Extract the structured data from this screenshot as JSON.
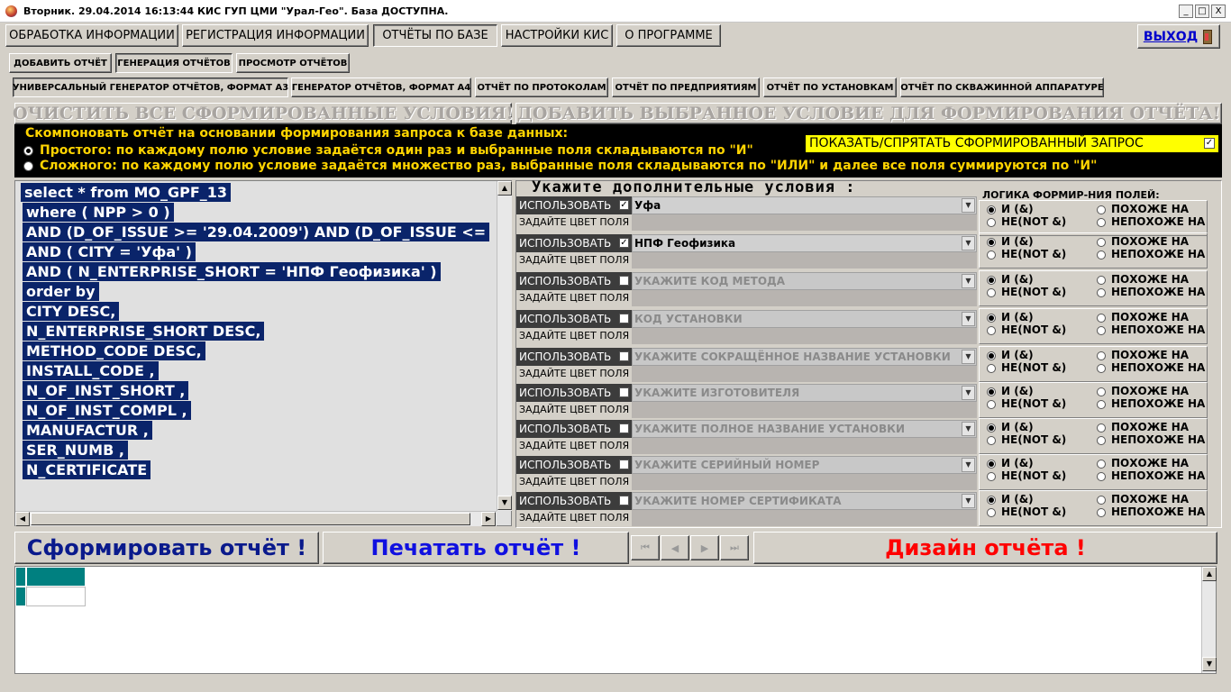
{
  "window": {
    "title": "Вторник. 29.04.2014 16:13:44  КИС ГУП ЦМИ \"Урал-Гео\". База ДОСТУПНА.",
    "min": "_",
    "max": "□",
    "close": "X"
  },
  "menu": {
    "items": [
      "ОБРАБОТКА ИНФОРМАЦИИ",
      "РЕГИСТРАЦИЯ ИНФОРМАЦИИ",
      "ОТЧЁТЫ ПО БАЗЕ",
      "НАСТРОЙКИ КИС",
      "О ПРОГРАММЕ"
    ],
    "exit": "ВЫХОД"
  },
  "subtabs": [
    "ДОБАВИТЬ ОТЧЁТ",
    "ГЕНЕРАЦИЯ ОТЧЁТОВ",
    "ПРОСМОТР ОТЧЁТОВ"
  ],
  "reporttabs": [
    "УНИВЕРСАЛЬНЫЙ ГЕНЕРАТОР ОТЧЁТОВ, ФОРМАТ А3",
    "ГЕНЕРАТОР ОТЧЁТОВ, ФОРМАТ А4",
    "ОТЧЁТ ПО ПРОТОКОЛАМ",
    "ОТЧЁТ ПО ПРЕДПРИЯТИЯМ",
    "ОТЧЁТ ПО УСТАНОВКАМ",
    "ОТЧЁТ ПО СКВАЖИННОЙ АППАРАТУРЕ"
  ],
  "actions": {
    "clear": "ОЧИСТИТЬ ВСЕ СФОРМИРОВАННЫЕ УСЛОВИЯ!",
    "add": "ДОБАВИТЬ ВЫБРАННОЕ УСЛОВИЕ ДЛЯ ФОРМИРОВАНИЯ  ОТЧЁТА!"
  },
  "mode": {
    "heading": "Скомпоновать отчёт на основании формирования запроса к базе данных:",
    "simple": "Простого: по каждому полю условие задаётся один раз и выбранные поля складываются по \"И\"",
    "complex": "Сложного: по каждому полю условие задаётся множество раз, выбранные поля складываются по \"ИЛИ\" и далее все поля суммируются по \"И\"",
    "toggle": "ПОКАЗАТЬ/СПРЯТАТЬ СФОРМИРОВАННЫЙ ЗАПРОС",
    "toggle_check": "✓"
  },
  "sql": [
    "select * from MO_GPF_13",
    " where  ( NPP > 0 )",
    "AND  (D_OF_ISSUE >= '29.04.2009') AND (D_OF_ISSUE <=",
    " AND ( CITY = 'Уфа' )",
    " AND ( N_ENTERPRISE_SHORT = 'НПФ Геофизика' )",
    " order by",
    " CITY DESC,",
    " N_ENTERPRISE_SHORT DESC,",
    " METHOD_CODE DESC,",
    " INSTALL_CODE ,",
    " N_OF_INST_SHORT ,",
    " N_OF_INST_COMPL ,",
    " MANUFACTUR ,",
    " SER_NUMB ,",
    " N_CERTIFICATE"
  ],
  "conditions": {
    "heading": "Укажите дополнительные условия :",
    "logic_heading": "ЛОГИКА ФОРМИР-НИЯ ПОЛЕЙ:",
    "use_label": "ИСПОЛЬЗОВАТЬ",
    "color_label": "ЗАДАЙТЕ ЦВЕТ ПОЛЯ",
    "check_mark": "✓",
    "dropdown": "▼",
    "opt_and": "И     (&)",
    "opt_not": "НЕ(NOT &)",
    "opt_like": "ПОХОЖЕ НА",
    "opt_notlike": "НЕПОХОЖЕ НА",
    "rows": [
      {
        "value": "Уфа",
        "checked": true
      },
      {
        "value": "НПФ Геофизика",
        "checked": true
      },
      {
        "value": "УКАЖИТЕ КОД МЕТОДА",
        "checked": false
      },
      {
        "value": "КОД УСТАНОВКИ",
        "checked": false
      },
      {
        "value": "УКАЖИТЕ СОКРАЩЁННОЕ НАЗВАНИЕ УСТАНОВКИ",
        "checked": false
      },
      {
        "value": "УКАЖИТЕ ИЗГОТОВИТЕЛЯ",
        "checked": false
      },
      {
        "value": "УКАЖИТЕ ПОЛНОЕ НАЗВАНИЕ УСТАНОВКИ",
        "checked": false
      },
      {
        "value": "УКАЖИТЕ СЕРИЙНЫЙ НОМЕР",
        "checked": false
      },
      {
        "value": "УКАЖИТЕ НОМЕР СЕРТИФИКАТА",
        "checked": false
      }
    ]
  },
  "bottom": {
    "form": "Сформировать отчёт !",
    "print": "Печатать отчёт !",
    "design": "Дизайн отчёта !",
    "nav": [
      "⏮",
      "◀",
      "▶",
      "⏭"
    ]
  },
  "colors": {
    "form": "#0a1a8c",
    "print": "#1010e0",
    "design": "#ff0000",
    "sqlhighlight": "#0a246a",
    "gridteal": "#008080"
  }
}
